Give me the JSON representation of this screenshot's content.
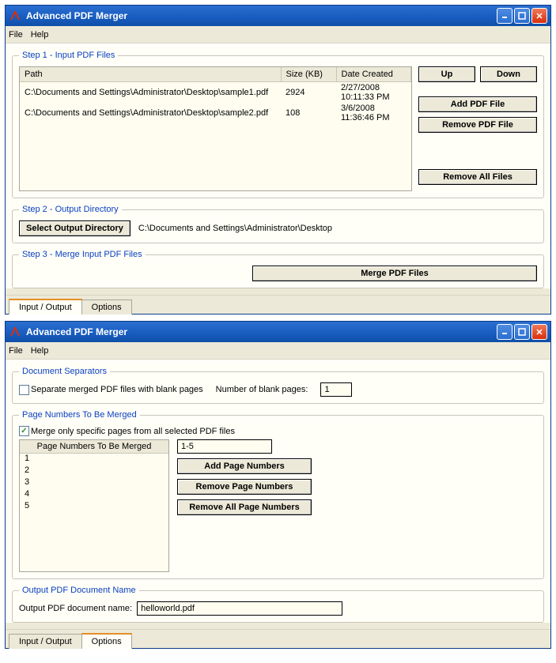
{
  "app_title": "Advanced PDF Merger",
  "menu": {
    "file": "File",
    "help": "Help"
  },
  "win1": {
    "groups": {
      "step1": "Step 1 - Input PDF Files",
      "step2": "Step 2 - Output Directory",
      "step3": "Step 3 - Merge Input PDF Files"
    },
    "columns": {
      "path": "Path",
      "size": "Size (KB)",
      "date": "Date Created"
    },
    "files": [
      {
        "path": "C:\\Documents and Settings\\Administrator\\Desktop\\sample1.pdf",
        "size": "2924",
        "date": "2/27/2008 10:11:33 PM"
      },
      {
        "path": "C:\\Documents and Settings\\Administrator\\Desktop\\sample2.pdf",
        "size": "108",
        "date": "3/6/2008 11:36:46 PM"
      }
    ],
    "buttons": {
      "up": "Up",
      "down": "Down",
      "add": "Add PDF File",
      "remove": "Remove PDF File",
      "remove_all": "Remove All Files",
      "select_dir": "Select Output Directory",
      "merge": "Merge PDF Files"
    },
    "output_dir": "C:\\Documents and Settings\\Administrator\\Desktop",
    "tabs": {
      "io": "Input / Output",
      "options": "Options"
    }
  },
  "win2": {
    "groups": {
      "sep": "Document Separators",
      "pn": "Page Numbers To Be Merged",
      "out": "Output PDF Document Name"
    },
    "sep": {
      "chk_label": "Separate merged PDF files with blank pages",
      "num_label": "Number of blank pages:",
      "num_value": "1",
      "checked": false
    },
    "pn": {
      "chk_label": "Merge only specific pages from all selected PDF files",
      "checked": true,
      "list_header": "Page Numbers To Be Merged",
      "list": [
        "1",
        "2",
        "3",
        "4",
        "5"
      ],
      "input_value": "1-5",
      "buttons": {
        "add": "Add Page Numbers",
        "remove": "Remove Page Numbers",
        "remove_all": "Remove All Page Numbers"
      }
    },
    "out": {
      "label": "Output PDF document name:",
      "value": "helloworld.pdf"
    },
    "tabs": {
      "io": "Input / Output",
      "options": "Options"
    }
  }
}
